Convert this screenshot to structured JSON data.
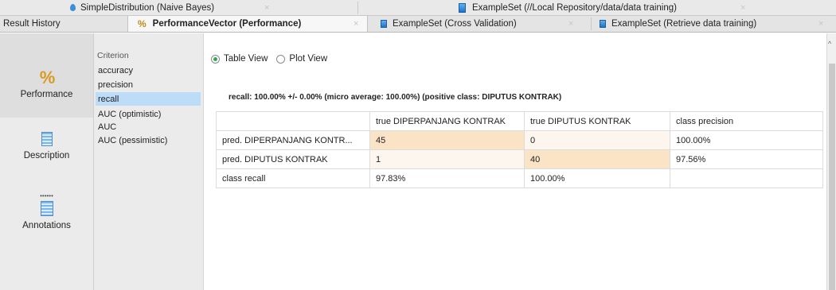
{
  "top_tabs": [
    {
      "label": "SimpleDistribution (Naive Bayes)",
      "close": "×"
    },
    {
      "label": "ExampleSet (//Local Repository/data/data training)",
      "close": "×"
    }
  ],
  "result_history": "Result History",
  "second_tabs": [
    {
      "label": "PerformanceVector (Performance)",
      "close": "×"
    },
    {
      "label": "ExampleSet (Cross Validation)",
      "close": "×"
    },
    {
      "label": "ExampleSet (Retrieve data training)",
      "close": "×"
    }
  ],
  "left_nav": [
    {
      "label": "Performance",
      "icon": "percent-icon"
    },
    {
      "label": "Description",
      "icon": "document-icon"
    },
    {
      "label": "Annotations",
      "icon": "annotations-icon"
    }
  ],
  "criterion": {
    "title": "Criterion",
    "items": [
      "accuracy",
      "precision",
      "recall",
      "AUC (optimistic)",
      "AUC",
      "AUC (pessimistic)"
    ],
    "selected": "recall"
  },
  "view_options": {
    "table": "Table View",
    "plot": "Plot View",
    "selected": "Table View"
  },
  "summary": "recall: 100.00% +/- 0.00% (micro average: 100.00%) (positive class: DIPUTUS KONTRAK)",
  "matrix": {
    "header": [
      "",
      "true DIPERPANJANG KONTRAK",
      "true DIPUTUS KONTRAK",
      "class precision"
    ],
    "rows": [
      [
        "pred. DIPERPANJANG KONTR...",
        "45",
        "0",
        "100.00%"
      ],
      [
        "pred. DIPUTUS KONTRAK",
        "1",
        "40",
        "97.56%"
      ],
      [
        "class recall",
        "97.83%",
        "100.00%",
        ""
      ]
    ]
  },
  "colors": {
    "highlight": "#fbe3c6",
    "selected_criterion": "#bcdcf8",
    "radio_on": "#2fa84f"
  }
}
